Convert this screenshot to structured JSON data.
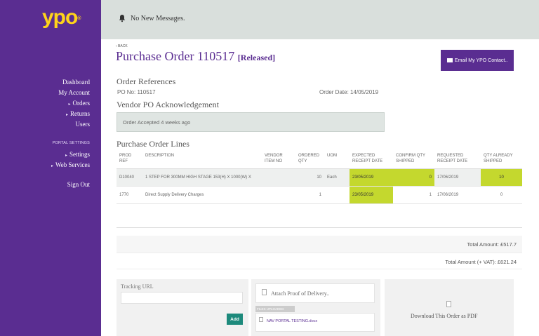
{
  "logo": {
    "text": "ypo",
    "tm": "®"
  },
  "sidebar": {
    "items": [
      {
        "label": "Dashboard",
        "caret": false
      },
      {
        "label": "My Account",
        "caret": false
      },
      {
        "label": "Orders",
        "caret": true
      },
      {
        "label": "Returns",
        "caret": true
      },
      {
        "label": "Users",
        "caret": false
      }
    ],
    "section_label": "PORTAL SETTINGS",
    "settings_items": [
      {
        "label": "Settings",
        "caret": true
      },
      {
        "label": "Web Services",
        "caret": true
      }
    ],
    "signout": "Sign Out"
  },
  "topbar": {
    "messages": "No New Messages."
  },
  "page": {
    "back": "‹ BACK",
    "title": "Purchase Order 110517",
    "status": "[Released]",
    "email_button": "Email My YPO Contact.."
  },
  "references": {
    "heading": "Order References",
    "po_no": "PO No: 110517",
    "order_date": "Order Date: 14/05/2019"
  },
  "acknowledgement": {
    "heading": "Vendor PO Acknowledgement",
    "message": "Order Accepted 4 weeks ago"
  },
  "lines": {
    "heading": "Purchase Order Lines",
    "columns": [
      "PROD REF",
      "DESCRIPTION",
      "VENDOR ITEM NO",
      "ORDERED QTY",
      "UOM",
      "EXPECTED RECEIPT DATE",
      "CONFIRM QTY SHIPPED",
      "REQUESTED RECEIPT DATE",
      "QTY ALREADY SHIPPED"
    ],
    "rows": [
      {
        "prod_ref": "D10040",
        "description": "1 STEP FOR 300MM HIGH STAGE 153(H) X 1000(W) X",
        "vendor_item_no": "",
        "ordered_qty": "10",
        "uom": "Each",
        "expected_receipt": "23/05/2019",
        "confirm_qty": "0",
        "requested_receipt": "17/06/2019",
        "qty_shipped": "10"
      },
      {
        "prod_ref": "1770",
        "description": "Direct Supply Delivery Charges",
        "vendor_item_no": "",
        "ordered_qty": "1",
        "uom": "",
        "expected_receipt": "23/05/2019",
        "confirm_qty": "1",
        "requested_receipt": "17/06/2019",
        "qty_shipped": "0"
      }
    ],
    "highlight_color": "#c4d82e"
  },
  "totals": {
    "total": "Total Amount: £517.7",
    "total_vat": "Total Amount (+ VAT): £621.24"
  },
  "tracking": {
    "label": "Tracking URL",
    "value": "",
    "add_button": "Add"
  },
  "proof": {
    "attach_label": "Attach Proof of Delivery..",
    "files_label": "FILES UPLOADED",
    "file_name": "NAV PORTAL TESTING.docx"
  },
  "download": {
    "label": "Download This Order as PDF"
  },
  "colors": {
    "brand_purple": "#5a2d91",
    "logo_yellow": "#ffd31a",
    "add_green": "#1d8a7c"
  }
}
